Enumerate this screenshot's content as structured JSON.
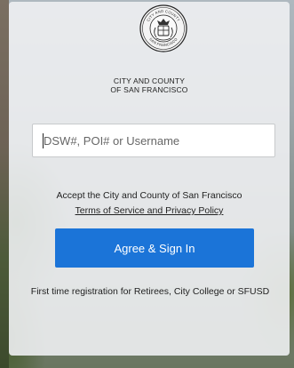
{
  "organization": {
    "name_line1": "CITY AND COUNTY",
    "name_line2": "OF SAN FRANCISCO",
    "seal_text_top": "CITY AND COUNTY",
    "seal_text_bottom": "SAN FRANCISCO"
  },
  "login": {
    "username_placeholder": "DSW#, POI# or Username",
    "terms_prefix": "Accept the City and County of San Francisco",
    "terms_link": "Terms of Service and Privacy Policy",
    "sign_in_button": "Agree & Sign In",
    "registration_link": "First time registration for Retirees, City College or SFUSD"
  },
  "colors": {
    "button_blue": "#1b74d8",
    "card_background": "#eef0f2"
  },
  "icons": [
    "city-seal-icon"
  ]
}
